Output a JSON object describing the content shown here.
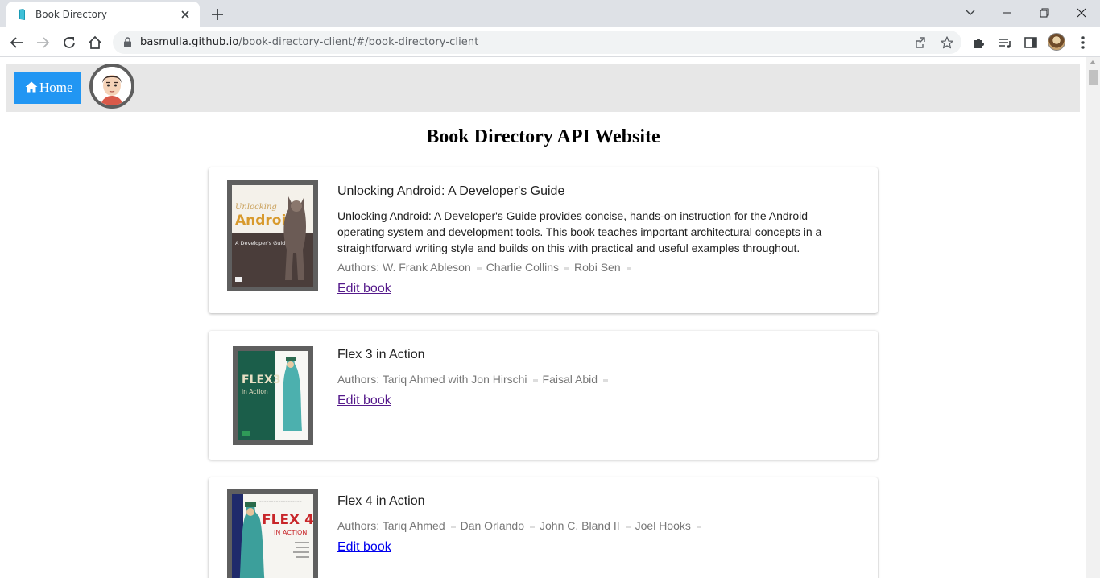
{
  "browser": {
    "tab_title": "Book Directory",
    "url_host": "basmulla.github.io",
    "url_path": "/book-directory-client/#/book-directory-client"
  },
  "nav": {
    "home_label": "Home"
  },
  "page": {
    "title": "Book Directory API Website"
  },
  "books": [
    {
      "title": "Unlocking Android: A Developer's Guide",
      "description": "Unlocking Android: A Developer's Guide provides concise, hands-on instruction for the Android operating system and development tools. This book teaches important architectural concepts in a straightforward writing style and builds on this with practical and useful examples throughout.",
      "authors_label": "Authors:",
      "authors": [
        "W. Frank Ableson",
        "Charlie Collins",
        "Robi Sen"
      ],
      "edit_label": "Edit book",
      "cover_text": [
        "Unlocking",
        "Android",
        "A Developer's Guide"
      ]
    },
    {
      "title": "Flex 3 in Action",
      "authors_label": "Authors:",
      "authors": [
        "Tariq Ahmed with Jon Hirschi",
        "Faisal Abid"
      ],
      "edit_label": "Edit book",
      "cover_text": [
        "FLEX3",
        "in Action"
      ]
    },
    {
      "title": "Flex 4 in Action",
      "authors_label": "Authors:",
      "authors": [
        "Tariq Ahmed",
        "Dan Orlando",
        "John C. Bland II",
        "Joel Hooks"
      ],
      "edit_label": "Edit book",
      "cover_text": [
        "FLEX 4",
        "IN ACTION"
      ]
    }
  ],
  "colors": {
    "home_button": "#2196f3",
    "navbar": "#e7e7e7",
    "link_visited": "#551a8b",
    "link": "#0000ee"
  }
}
